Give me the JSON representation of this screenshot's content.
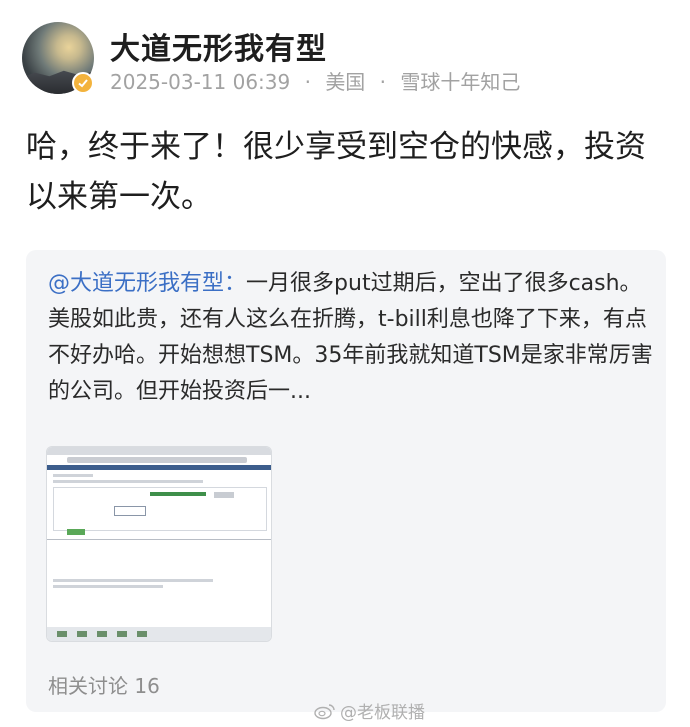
{
  "post": {
    "username": "大道无形我有型",
    "timestamp": "2025-03-11 06:39",
    "location": "美国",
    "separator": "·",
    "badge_text": "雪球十年知己",
    "body": "哈，终于来了！很少享受到空仓的快感，投资以来第一次。"
  },
  "quote": {
    "mention": "@大道无形我有型",
    "colon": "：",
    "text": "一月很多put过期后，空出了很多cash。美股如此贵，还有人这么在折腾，t-bill利息也降了下来，有点不好办哈。开始想想TSM。35年前我就知道TSM是家非常厉害的公司。但开始投资后一...",
    "related_label": "相关讨论 16"
  },
  "watermark": {
    "text": "@老板联播"
  },
  "colors": {
    "mention": "#3b6fc5",
    "badge": "#f3b33d",
    "meta_gray": "#a2a2a2",
    "card_bg": "#f4f5f7"
  }
}
